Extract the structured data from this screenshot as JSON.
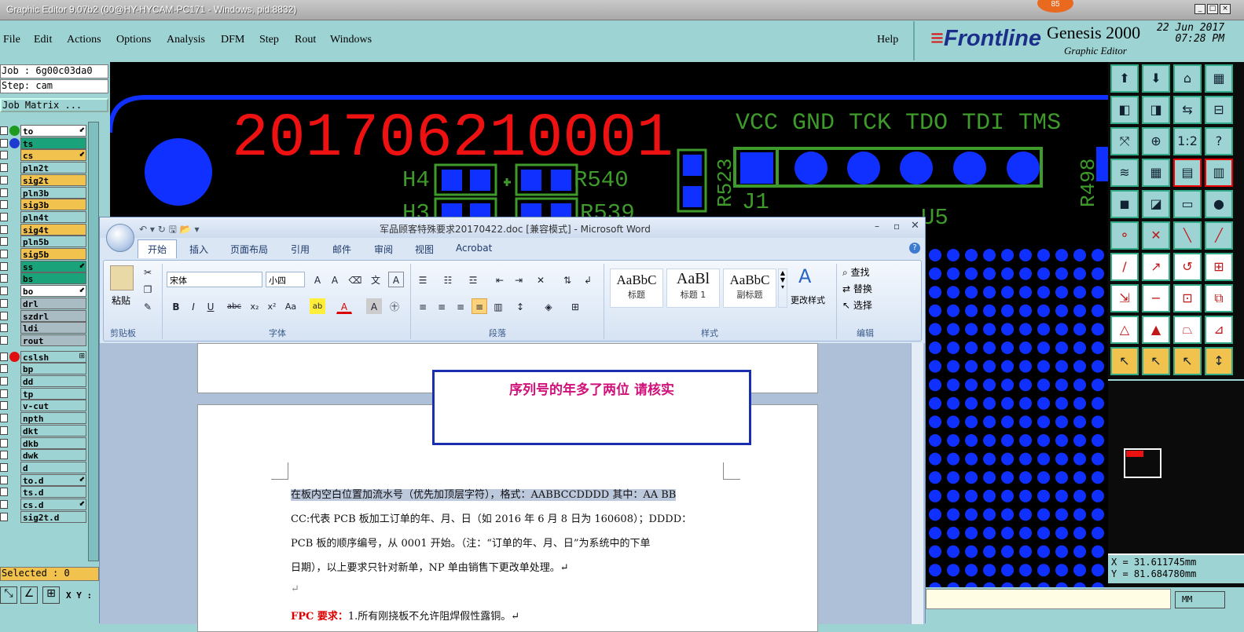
{
  "app": {
    "title": "Graphic Editor 9.07b2 (00@HY-HYCAM-PC171 - Windows, pid:8832)",
    "badge": "85",
    "win_controls": [
      "_",
      "□",
      "×"
    ]
  },
  "menu": {
    "items": [
      "File",
      "Edit",
      "Actions",
      "Options",
      "Analysis",
      "DFM",
      "Step",
      "Rout",
      "Windows"
    ],
    "help": "Help"
  },
  "logo": {
    "brand": "Frontline",
    "product": "Genesis 2000",
    "subtitle": "Graphic Editor",
    "date": "22 Jun 2017",
    "time": "07:28 PM"
  },
  "job": {
    "job": "Job : 6g00c03da0",
    "step": "Step: cam",
    "matrix_button": "Job Matrix ..."
  },
  "layers": [
    {
      "name": "to",
      "color": "#ffffff",
      "dot": "#1e9a1e",
      "flag": "⬋"
    },
    {
      "name": "ts",
      "color": "#1aa37a",
      "dot": "#1f3ad0",
      "flag": ""
    },
    {
      "name": "cs",
      "color": "#f2c24f",
      "dot": "",
      "flag": "⬋"
    },
    {
      "name": "pln2t",
      "color": "#9ed3d3",
      "dot": "",
      "flag": ""
    },
    {
      "name": "sig2t",
      "color": "#f2c24f",
      "dot": "",
      "flag": ""
    },
    {
      "name": "pln3b",
      "color": "#9ed3d3",
      "dot": "",
      "flag": ""
    },
    {
      "name": "sig3b",
      "color": "#f2c24f",
      "dot": "",
      "flag": ""
    },
    {
      "name": "pln4t",
      "color": "#9ed3d3",
      "dot": "",
      "flag": ""
    },
    {
      "name": "sig4t",
      "color": "#f2c24f",
      "dot": "",
      "flag": ""
    },
    {
      "name": "pln5b",
      "color": "#9ed3d3",
      "dot": "",
      "flag": ""
    },
    {
      "name": "sig5b",
      "color": "#f2c24f",
      "dot": "",
      "flag": ""
    },
    {
      "name": "ss",
      "color": "#1aa37a",
      "dot": "",
      "flag": "⬋"
    },
    {
      "name": "bs",
      "color": "#1aa37a",
      "dot": "",
      "flag": ""
    },
    {
      "name": "bo",
      "color": "#ffffff",
      "dot": "",
      "flag": "⬋"
    },
    {
      "name": "drl",
      "color": "#a9bcc4",
      "dot": "",
      "flag": ""
    },
    {
      "name": "szdrl",
      "color": "#a9bcc4",
      "dot": "",
      "flag": ""
    },
    {
      "name": "ldi",
      "color": "#a9bcc4",
      "dot": "",
      "flag": ""
    },
    {
      "name": "rout",
      "color": "#a9bcc4",
      "dot": "",
      "flag": ""
    },
    {
      "name": "cslsh",
      "color": "#9ed3d3",
      "dot": "#e01010",
      "flag": "⊞"
    },
    {
      "name": "bp",
      "color": "#9ed3d3",
      "dot": "",
      "flag": ""
    },
    {
      "name": "dd",
      "color": "#9ed3d3",
      "dot": "",
      "flag": ""
    },
    {
      "name": "tp",
      "color": "#9ed3d3",
      "dot": "",
      "flag": ""
    },
    {
      "name": "v-cut",
      "color": "#9ed3d3",
      "dot": "",
      "flag": ""
    },
    {
      "name": "npth",
      "color": "#9ed3d3",
      "dot": "",
      "flag": ""
    },
    {
      "name": "dkt",
      "color": "#9ed3d3",
      "dot": "",
      "flag": ""
    },
    {
      "name": "dkb",
      "color": "#9ed3d3",
      "dot": "",
      "flag": ""
    },
    {
      "name": "dwk",
      "color": "#9ed3d3",
      "dot": "",
      "flag": ""
    },
    {
      "name": "d",
      "color": "#9ed3d3",
      "dot": "",
      "flag": ""
    },
    {
      "name": "to.d",
      "color": "#9ed3d3",
      "dot": "",
      "flag": "⬋"
    },
    {
      "name": "ts.d",
      "color": "#9ed3d3",
      "dot": "",
      "flag": ""
    },
    {
      "name": "cs.d",
      "color": "#9ed3d3",
      "dot": "",
      "flag": "⬋"
    },
    {
      "name": "sig2t.d",
      "color": "#9ed3d3",
      "dot": "",
      "flag": ""
    }
  ],
  "status": {
    "selected": "Selected : 0",
    "xy_label": "X Y :"
  },
  "pcb": {
    "serial": "201706210001",
    "pins": "VCC GND TCK TDO TDI TMS",
    "labels": [
      "H4",
      "R540",
      "H3",
      "R539",
      "R523",
      "J1",
      "U5",
      "R498"
    ],
    "silk_color": "#3e9a2a",
    "pad_color": "#1030ff",
    "text_color": "#ee1111"
  },
  "toolbar_icons": [
    "zoom-home-icon",
    "zoom-in-icon",
    "zoom-out-icon",
    "grid-icon",
    "pan-left-icon",
    "pan-right-icon",
    "flip-icon",
    "snap-icon",
    "fit-icon",
    "center-icon",
    "one-to-one-icon",
    "help-icon",
    "measure-icon",
    "grid-toggle-icon",
    "layer-red-icon",
    "layer-blue-icon",
    "fill-icon",
    "outline-icon",
    "ruler-icon",
    "dot-icon",
    "connect-icon",
    "cross-icon",
    "line-icon",
    "diagonal-icon",
    "angle-icon",
    "arrow-icon",
    "arc-icon",
    "frame-icon",
    "node-icon",
    "minus-icon",
    "resize-icon",
    "group-icon",
    "polygon-icon",
    "tri-icon",
    "trap-icon",
    "ramp-icon",
    "select-icon",
    "select2-icon",
    "select3-icon",
    "select4-icon"
  ],
  "coords": {
    "x": "X = 31.611745mm",
    "y": "Y = 81.684780mm",
    "units": "MM"
  },
  "word": {
    "title": "军品顾客特殊要求20170422.doc [兼容模式] - Microsoft Word",
    "tabs": [
      "开始",
      "插入",
      "页面布局",
      "引用",
      "邮件",
      "审阅",
      "视图",
      "Acrobat"
    ],
    "groups": [
      "剪贴板",
      "字体",
      "段落",
      "样式",
      "编辑"
    ],
    "paste": "粘贴",
    "font_name": "宋体",
    "font_size": "小四",
    "styles": [
      {
        "sample": "AaBbC",
        "name": "标题"
      },
      {
        "sample": "AaBl",
        "name": "标题 1"
      },
      {
        "sample": "AaBbC",
        "name": "副标题"
      }
    ],
    "change_styles": "更改样式",
    "find": "查找",
    "replace": "替换",
    "select": "选择",
    "callout": "序列号的年多了两位    请核实",
    "paragraph": [
      "在板内空白位置加流水号（优先加顶层字符），格式：AABBCCDDDD   其中：AA BB",
      "CC:代表 PCB 板加工订单的年、月、日（如 2016 年 6 月 8 日为 160608）；DDDD：",
      "PCB 板的顺序编号，从 0001 开始。（注：“订单的年、月、日”为系统中的下单",
      "日期），以上要求只针对新单，NP 单由销售下更改单处理。↵"
    ],
    "return_mark": "↵",
    "fpc_label": "FPC 要求：",
    "fpc_text": "1.所有刚挠板不允许阻焊假性露铜。↵"
  }
}
